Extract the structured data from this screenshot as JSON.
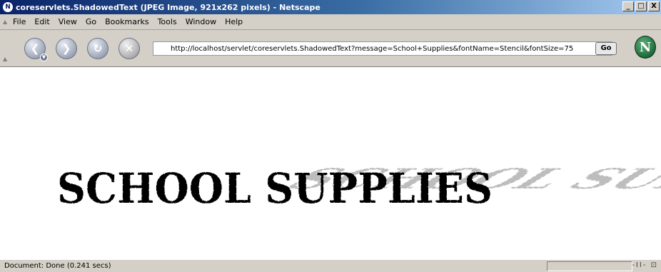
{
  "window": {
    "title": "coreservlets.ShadowedText (JPEG Image, 921x262 pixels) - Netscape",
    "app_icon": "netscape-icon",
    "controls": {
      "minimize": "_",
      "maximize": "□",
      "close": "X"
    }
  },
  "menubar": {
    "items": [
      "File",
      "Edit",
      "View",
      "Go",
      "Bookmarks",
      "Tools",
      "Window",
      "Help"
    ]
  },
  "navbar": {
    "back_icon": "back-arrow-icon",
    "forward_icon": "forward-arrow-icon",
    "reload_icon": "reload-icon",
    "stop_icon": "stop-icon",
    "url": "http://localhost/servlet/coreservlets.ShadowedText?message=School+Supplies&fontName=Stencil&fontSize=75",
    "go_label": "Go",
    "logo_letter": "N"
  },
  "content": {
    "image_text": "SCHOOL SUPPLIES",
    "text_color": "#000000",
    "shadow_color": "#bdbdbd"
  },
  "statusbar": {
    "text": "Document: Done (0.241 secs)",
    "icons": "-II- ⊡"
  }
}
